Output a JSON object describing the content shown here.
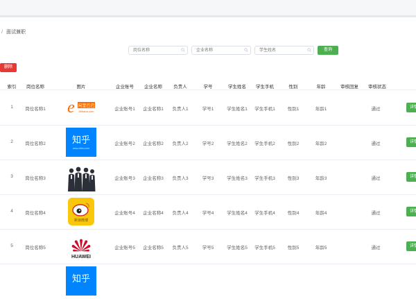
{
  "breadcrumb": {
    "current": "面试兼职"
  },
  "search": {
    "placeholder_1": "岗位名称",
    "placeholder_2": "企业名称",
    "placeholder_3": "学生姓名",
    "query_label": "查询"
  },
  "actions": {
    "delete_label": "删除"
  },
  "table": {
    "columns": [
      "索引",
      "岗位名称",
      "图片",
      "企业账号",
      "企业名称",
      "负责人",
      "学号",
      "学生姓名",
      "学生手机",
      "性别",
      "年龄",
      "审核回复",
      "审核状态"
    ],
    "detail_label": "详情",
    "rows": [
      {
        "index": "1",
        "position": "岗位名称1",
        "image": "alibaba-logo",
        "account": "企业账号1",
        "company": "企业名称1",
        "leader": "负责人1",
        "sid": "学号1",
        "sname": "学生姓名1",
        "phone": "学生手机1",
        "gender": "性别1",
        "age": "年龄1",
        "reply": "",
        "status": "通过"
      },
      {
        "index": "2",
        "position": "岗位名称2",
        "image": "zhihu-logo",
        "account": "企业账号2",
        "company": "企业名称2",
        "leader": "负责人2",
        "sid": "学号2",
        "sname": "学生姓名2",
        "phone": "学生手机2",
        "gender": "性别2",
        "age": "年龄2",
        "reply": "",
        "status": "通过"
      },
      {
        "index": "3",
        "position": "岗位名称3",
        "image": "business-people-photo",
        "account": "企业账号3",
        "company": "企业名称3",
        "leader": "负责人3",
        "sid": "学号3",
        "sname": "学生姓名3",
        "phone": "学生手机3",
        "gender": "性别3",
        "age": "年龄3",
        "reply": "",
        "status": "通过"
      },
      {
        "index": "4",
        "position": "岗位名称4",
        "image": "weibo-logo",
        "account": "企业账号4",
        "company": "企业名称4",
        "leader": "负责人4",
        "sid": "学号4",
        "sname": "学生姓名4",
        "phone": "学生手机4",
        "gender": "性别4",
        "age": "年龄4",
        "reply": "",
        "status": "通过"
      },
      {
        "index": "5",
        "position": "岗位名称5",
        "image": "huawei-logo",
        "account": "企业账号5",
        "company": "企业名称5",
        "leader": "负责人5",
        "sid": "学号5",
        "sname": "学生姓名5",
        "phone": "学生手机5",
        "gender": "性别5",
        "age": "年龄5",
        "reply": "",
        "status": "通过"
      }
    ]
  },
  "logos": {
    "zhihu_text": "知乎",
    "zhihu_sub": "www.zhihu.com",
    "alibaba_text": "阿里巴巴",
    "alibaba_sub": "Alibaba.com",
    "huawei_text": "HUAWEI",
    "weibo_text": "新浪微博"
  },
  "colors": {
    "primary": "#4caf50",
    "danger": "#e53935",
    "zhihu_blue": "#0084ff",
    "huawei_red": "#cf0a2c",
    "alibaba_orange": "#ff6a00"
  }
}
